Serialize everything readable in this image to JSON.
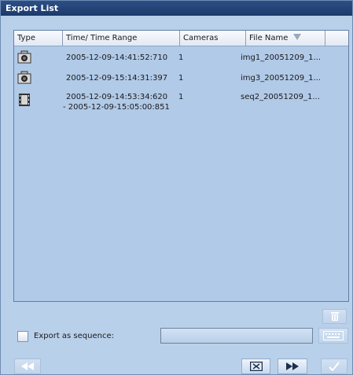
{
  "window": {
    "title": "Export List"
  },
  "list": {
    "columns": [
      "Type",
      "Time/ Time Range",
      "Cameras",
      "File Name"
    ],
    "rows": [
      {
        "type_icon": "camera-icon",
        "time": "2005-12-09-14:41:52:710",
        "time_end": "",
        "cameras": "1",
        "file_name": "img1_20051209_1..."
      },
      {
        "type_icon": "camera-icon",
        "time": "2005-12-09-15:14:31:397",
        "time_end": "",
        "cameras": "1",
        "file_name": "img3_20051209_1..."
      },
      {
        "type_icon": "film-icon",
        "time": "2005-12-09-14:53:34:620",
        "time_end": "- 2005-12-09-15:05:00:851",
        "cameras": "1",
        "file_name": "seq2_20051209_1..."
      }
    ]
  },
  "footer": {
    "export_sequence_label": "Export as sequence:",
    "sequence_value": "",
    "icons": {
      "delete": "trash-icon",
      "keyboard": "keyboard-icon",
      "rewind": "rewind-icon",
      "stop": "stop-icon",
      "forward": "fast-forward-icon",
      "confirm": "checkmark-icon"
    }
  }
}
